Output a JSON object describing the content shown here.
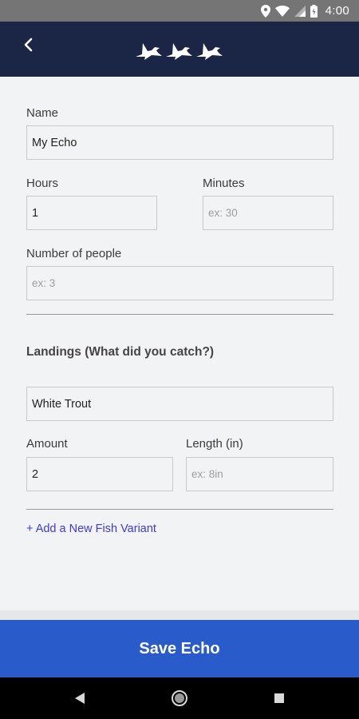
{
  "status_bar": {
    "time": "4:00"
  },
  "form": {
    "name_label": "Name",
    "name_value": "My Echo",
    "hours_label": "Hours",
    "hours_value": "1",
    "minutes_label": "Minutes",
    "minutes_placeholder": "ex: 30",
    "people_label": "Number of people",
    "people_placeholder": "ex: 3",
    "landings_heading": "Landings (What did you catch?)",
    "fish_value": "White Trout",
    "amount_label": "Amount",
    "amount_value": "2",
    "length_label": "Length (in)",
    "length_placeholder": "ex: 8in",
    "add_variant_link": "+ Add a New Fish Variant"
  },
  "save_button": {
    "label": "Save Echo"
  },
  "colors": {
    "app_bar": "#1b2646",
    "primary": "#2a5bcb",
    "link": "#3d3ae0"
  }
}
